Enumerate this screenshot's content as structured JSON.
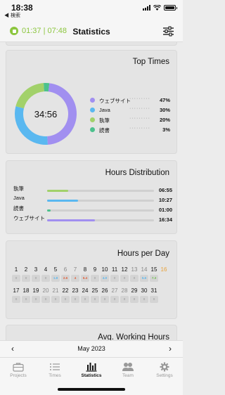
{
  "status_bar": {
    "time": "18:38",
    "back_label": "◀ 検索"
  },
  "header": {
    "timer": "01:37 | 07:48",
    "title": "Statistics"
  },
  "top_times": {
    "title": "Top Times",
    "total": "34:56",
    "items": [
      {
        "label": "ウェブサイト",
        "percent": "47%",
        "value": 47,
        "color": "#a18ff0"
      },
      {
        "label": "Java",
        "percent": "30%",
        "value": 30,
        "color": "#5ab8f0"
      },
      {
        "label": "執筆",
        "percent": "20%",
        "value": 20,
        "color": "#a2d16a"
      },
      {
        "label": "読書",
        "percent": "3%",
        "value": 3,
        "color": "#4cc18d"
      }
    ]
  },
  "hours_distribution": {
    "title": "Hours Distribution",
    "rows": [
      {
        "label": "執筆",
        "value": "06:55",
        "fraction": 0.2,
        "color": "#a2d16a"
      },
      {
        "label": "Java",
        "value": "10:27",
        "fraction": 0.29,
        "color": "#5ab8f0"
      },
      {
        "label": "読書",
        "value": "01:00",
        "fraction": 0.03,
        "color": "#4cc18d"
      },
      {
        "label": "ウェブサイト",
        "value": "16:34",
        "fraction": 0.45,
        "color": "#a18ff0"
      }
    ]
  },
  "hours_per_day": {
    "title": "Hours per Day",
    "days": [
      {
        "day": "1",
        "val": "0"
      },
      {
        "day": "2",
        "val": "0"
      },
      {
        "day": "3",
        "val": "0"
      },
      {
        "day": "4",
        "val": "0"
      },
      {
        "day": "5",
        "val": "1.8"
      },
      {
        "day": "6",
        "val": "2.6"
      },
      {
        "day": "7",
        "val": "4"
      },
      {
        "day": "8",
        "val": "6.4"
      },
      {
        "day": "9",
        "val": "0"
      },
      {
        "day": "10",
        "val": "4.0"
      },
      {
        "day": "11",
        "val": "0"
      },
      {
        "day": "12",
        "val": "0"
      },
      {
        "day": "13",
        "val": "0"
      },
      {
        "day": "14",
        "val": "5.6"
      },
      {
        "day": "15",
        "val": "7.3"
      },
      {
        "day": "16",
        "val": ""
      },
      {
        "day": "17",
        "val": "0"
      },
      {
        "day": "18",
        "val": "0"
      },
      {
        "day": "19",
        "val": "0"
      },
      {
        "day": "20",
        "val": "0"
      },
      {
        "day": "21",
        "val": "0"
      },
      {
        "day": "22",
        "val": "0"
      },
      {
        "day": "23",
        "val": "0"
      },
      {
        "day": "24",
        "val": "0"
      },
      {
        "day": "25",
        "val": "0"
      },
      {
        "day": "26",
        "val": "0"
      },
      {
        "day": "27",
        "val": "0"
      },
      {
        "day": "28",
        "val": "0"
      },
      {
        "day": "29",
        "val": "0"
      },
      {
        "day": "30",
        "val": "0"
      },
      {
        "day": "31",
        "val": "0"
      }
    ],
    "value_colors": {
      "1.8": "#5ab8f0",
      "2.6": "#e0603a",
      "4": "#e0603a",
      "6.4": "#e0603a",
      "4.0": "#5ab8f0",
      "5.6": "#5ab8f0",
      "7.3": "#6cbf4a"
    },
    "weekend_color": "#888888",
    "today_color": "#e8a23a"
  },
  "avg_working_hours": {
    "title": "Avg. Working Hours"
  },
  "month_nav": {
    "prev": "‹",
    "label": "May 2023",
    "next": "›"
  },
  "tabs": [
    {
      "label": "Projects",
      "icon": "briefcase-icon"
    },
    {
      "label": "Times",
      "icon": "list-icon"
    },
    {
      "label": "Statistics",
      "icon": "bar-chart-icon",
      "active": true
    },
    {
      "label": "Team",
      "icon": "team-icon"
    },
    {
      "label": "Settings",
      "icon": "gear-icon"
    }
  ],
  "chart_data": {
    "type": "pie",
    "categories": [
      "ウェブサイト",
      "Java",
      "執筆",
      "読書"
    ],
    "values": [
      47,
      30,
      20,
      3
    ],
    "title": "Top Times"
  }
}
